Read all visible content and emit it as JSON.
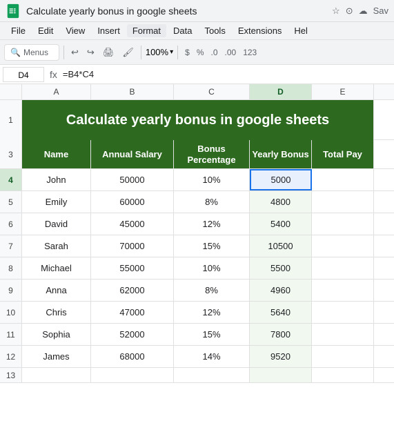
{
  "titleBar": {
    "title": "Calculate yearly bonus in google sheets",
    "saveLabel": "Sav",
    "icons": [
      "star",
      "cloud",
      "save"
    ]
  },
  "menuBar": {
    "items": [
      "File",
      "Edit",
      "View",
      "Insert",
      "Format",
      "Data",
      "Tools",
      "Extensions",
      "Hel"
    ]
  },
  "toolbar": {
    "searchPlaceholder": "Menus",
    "zoom": "100%",
    "currency": "$",
    "percent": "%",
    "decDecimals": ".0",
    "incDecimals": ".00",
    "number": "123"
  },
  "formulaBar": {
    "cellRef": "D4",
    "formula": "=B4*C4"
  },
  "columns": {
    "labels": [
      "",
      "A",
      "B",
      "C",
      "D",
      "E"
    ]
  },
  "spreadsheet": {
    "title": "Calculate yearly bonus in google sheets",
    "headers": {
      "name": "Name",
      "salary": "Annual Salary",
      "bonusPct": "Bonus Percentage",
      "yearlyBonus": "Yearly Bonus",
      "totalPay": "Total Pay"
    },
    "rows": [
      {
        "row": 4,
        "name": "John",
        "salary": "50000",
        "bonusPct": "10%",
        "bonus": "5000",
        "totalPay": ""
      },
      {
        "row": 5,
        "name": "Emily",
        "salary": "60000",
        "bonusPct": "8%",
        "bonus": "4800",
        "totalPay": ""
      },
      {
        "row": 6,
        "name": "David",
        "salary": "45000",
        "bonusPct": "12%",
        "bonus": "5400",
        "totalPay": ""
      },
      {
        "row": 7,
        "name": "Sarah",
        "salary": "70000",
        "bonusPct": "15%",
        "bonus": "10500",
        "totalPay": ""
      },
      {
        "row": 8,
        "name": "Michael",
        "salary": "55000",
        "bonusPct": "10%",
        "bonus": "5500",
        "totalPay": ""
      },
      {
        "row": 9,
        "name": "Anna",
        "salary": "62000",
        "bonusPct": "8%",
        "bonus": "4960",
        "totalPay": ""
      },
      {
        "row": 10,
        "name": "Chris",
        "salary": "47000",
        "bonusPct": "12%",
        "bonus": "5640",
        "totalPay": ""
      },
      {
        "row": 11,
        "name": "Sophia",
        "salary": "52000",
        "bonusPct": "15%",
        "bonus": "7800",
        "totalPay": ""
      },
      {
        "row": 12,
        "name": "James",
        "salary": "68000",
        "bonusPct": "14%",
        "bonus": "9520",
        "totalPay": ""
      }
    ]
  }
}
